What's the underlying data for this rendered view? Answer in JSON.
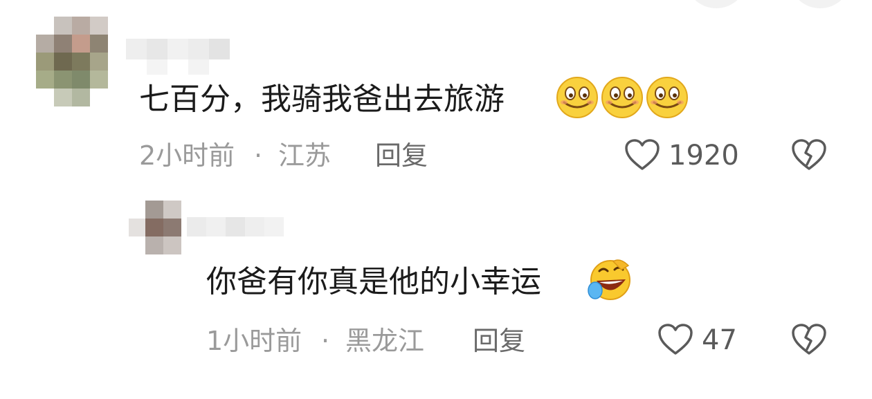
{
  "comments": [
    {
      "text": "七百分，我骑我爸出去旅游",
      "emojis": [
        "smile-emoji",
        "smile-emoji",
        "smile-emoji"
      ],
      "time": "2小时前",
      "separator": "·",
      "location": "江苏",
      "reply_label": "回复",
      "likes": "1920"
    },
    {
      "text": "你爸有你真是他的小幸运",
      "emojis": [
        "laugh-cry-emoji"
      ],
      "time": "1小时前",
      "separator": "·",
      "location": "黑龙江",
      "reply_label": "回复",
      "likes": "47"
    }
  ]
}
